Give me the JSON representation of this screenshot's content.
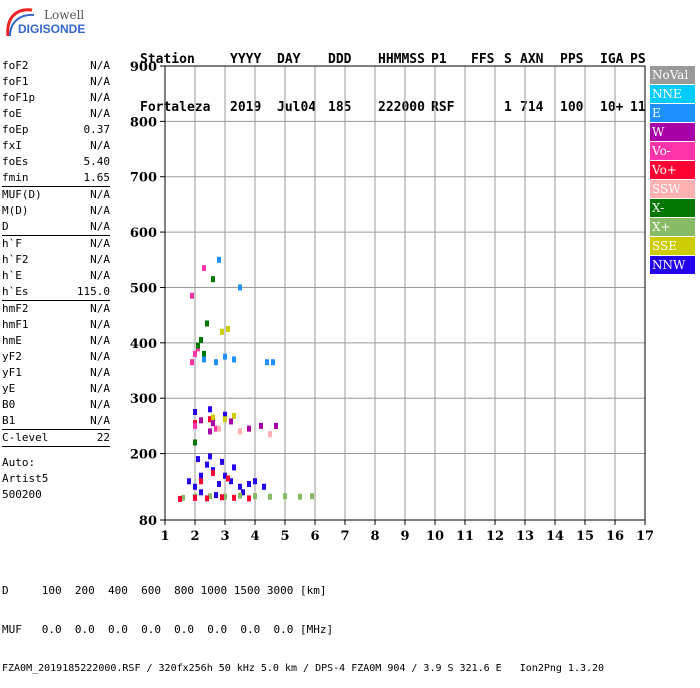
{
  "logo": {
    "line1": "Lowell",
    "line2": "DIGISONDE"
  },
  "header": {
    "labels": [
      "Station",
      "YYYY",
      "DAY",
      "DDD",
      "HHMMSS",
      "P1",
      "FFS",
      "S",
      "AXN",
      "PPS",
      "IGA",
      "PS"
    ],
    "values": [
      "Fortaleza",
      "2019",
      "Jul04",
      "185",
      "222000",
      "RSF",
      "",
      "1",
      "714",
      "100",
      "10+",
      "11"
    ]
  },
  "params": [
    {
      "label": "foF2",
      "value": "N/A"
    },
    {
      "label": "foF1",
      "value": "N/A"
    },
    {
      "label": "foF1p",
      "value": "N/A"
    },
    {
      "label": "foE",
      "value": "N/A"
    },
    {
      "label": "foEp",
      "value": "0.37"
    },
    {
      "label": "fxI",
      "value": "N/A"
    },
    {
      "label": "foEs",
      "value": "5.40"
    },
    {
      "label": "fmin",
      "value": "1.65",
      "sep": true
    },
    {
      "label": "MUF(D)",
      "value": "N/A"
    },
    {
      "label": "M(D)",
      "value": "N/A"
    },
    {
      "label": "D",
      "value": "N/A",
      "sep": true
    },
    {
      "label": "h`F",
      "value": "N/A"
    },
    {
      "label": "h`F2",
      "value": "N/A"
    },
    {
      "label": "h`E",
      "value": "N/A"
    },
    {
      "label": "h`Es",
      "value": "115.0",
      "sep": true
    },
    {
      "label": "hmF2",
      "value": "N/A"
    },
    {
      "label": "hmF1",
      "value": "N/A"
    },
    {
      "label": "hmE",
      "value": "N/A"
    },
    {
      "label": "yF2",
      "value": "N/A"
    },
    {
      "label": "yF1",
      "value": "N/A"
    },
    {
      "label": "yE",
      "value": "N/A"
    },
    {
      "label": "B0",
      "value": "N/A"
    },
    {
      "label": "B1",
      "value": "N/A",
      "sep": true
    },
    {
      "label": "C-level",
      "value": "22",
      "sep": true
    }
  ],
  "auto": [
    "Auto:",
    "Artist5",
    "500200"
  ],
  "legend": [
    {
      "label": "NoVal",
      "color": "#999999"
    },
    {
      "label": "NNE",
      "color": "#00ccff"
    },
    {
      "label": "E",
      "color": "#1e90ff"
    },
    {
      "label": "W",
      "color": "#a600a6"
    },
    {
      "label": "Vo-",
      "color": "#ff33aa"
    },
    {
      "label": "Vo+",
      "color": "#ff0033"
    },
    {
      "label": "SSW",
      "color": "#ffb0b0"
    },
    {
      "label": "X-",
      "color": "#007700"
    },
    {
      "label": "X+",
      "color": "#88bb66"
    },
    {
      "label": "SSE",
      "color": "#cccc00"
    },
    {
      "label": "NNW",
      "color": "#2200ee"
    }
  ],
  "footer": {
    "line1": "D     100  200  400  600  800 1000 1500 3000 [km]",
    "line2": "MUF   0.0  0.0  0.0  0.0  0.0  0.0  0.0  0.0 [MHz]",
    "line3": "FZA0M_2019185222000.RSF / 320fx256h 50 kHz 5.0 km / DPS-4 FZA0M 904 / 3.9 S 321.6 E   Ion2Png 1.3.20"
  },
  "chart_data": {
    "type": "scatter",
    "xlim": [
      1,
      17
    ],
    "ylim": [
      80,
      900
    ],
    "x_ticks": [
      1,
      2,
      3,
      4,
      5,
      6,
      7,
      8,
      9,
      10,
      11,
      12,
      13,
      14,
      15,
      16,
      17
    ],
    "y_ticks": [
      80,
      200,
      300,
      400,
      500,
      600,
      700,
      800,
      900
    ],
    "grid": true,
    "series": [
      {
        "name": "NNW",
        "color": "#2200ee",
        "points": [
          [
            1.8,
            150
          ],
          [
            2.0,
            140
          ],
          [
            2.2,
            160
          ],
          [
            2.4,
            180
          ],
          [
            2.6,
            170
          ],
          [
            2.8,
            145
          ],
          [
            3.0,
            160
          ],
          [
            3.2,
            150
          ],
          [
            3.5,
            140
          ],
          [
            3.8,
            145
          ],
          [
            4.0,
            150
          ],
          [
            4.3,
            140
          ],
          [
            2.1,
            190
          ],
          [
            2.5,
            195
          ],
          [
            2.9,
            185
          ],
          [
            3.3,
            175
          ],
          [
            2.2,
            130
          ],
          [
            2.7,
            125
          ],
          [
            3.6,
            130
          ],
          [
            2.0,
            275
          ],
          [
            2.5,
            280
          ],
          [
            3.0,
            270
          ]
        ]
      },
      {
        "name": "X+",
        "color": "#88bb66",
        "points": [
          [
            1.6,
            120
          ],
          [
            2.0,
            122
          ],
          [
            2.5,
            123
          ],
          [
            3.0,
            122
          ],
          [
            3.5,
            124
          ],
          [
            4.0,
            123
          ],
          [
            4.5,
            122
          ],
          [
            5.0,
            123
          ],
          [
            5.5,
            122
          ],
          [
            5.9,
            123
          ]
        ]
      },
      {
        "name": "Vo+",
        "color": "#ff0033",
        "points": [
          [
            1.5,
            118
          ],
          [
            2.0,
            120
          ],
          [
            2.4,
            119
          ],
          [
            2.9,
            121
          ],
          [
            3.3,
            120
          ],
          [
            3.8,
            119
          ],
          [
            2.2,
            150
          ],
          [
            2.6,
            165
          ],
          [
            3.1,
            155
          ],
          [
            2.0,
            255
          ],
          [
            2.5,
            262
          ]
        ]
      },
      {
        "name": "Vo-",
        "color": "#ff33aa",
        "points": [
          [
            1.9,
            365
          ],
          [
            2.0,
            380
          ],
          [
            2.1,
            390
          ],
          [
            1.9,
            485
          ],
          [
            2.3,
            535
          ],
          [
            2.0,
            250
          ],
          [
            2.7,
            245
          ]
        ]
      },
      {
        "name": "X-",
        "color": "#007700",
        "points": [
          [
            2.1,
            395
          ],
          [
            2.2,
            405
          ],
          [
            2.4,
            435
          ],
          [
            2.6,
            515
          ],
          [
            2.0,
            220
          ],
          [
            2.3,
            380
          ]
        ]
      },
      {
        "name": "SSE",
        "color": "#cccc00",
        "points": [
          [
            2.6,
            265
          ],
          [
            3.0,
            262
          ],
          [
            3.3,
            268
          ],
          [
            2.9,
            420
          ],
          [
            3.1,
            425
          ]
        ]
      },
      {
        "name": "E",
        "color": "#1e90ff",
        "points": [
          [
            2.3,
            370
          ],
          [
            2.7,
            365
          ],
          [
            3.0,
            375
          ],
          [
            3.3,
            370
          ],
          [
            4.4,
            365
          ],
          [
            4.6,
            365
          ],
          [
            3.5,
            500
          ],
          [
            2.8,
            550
          ]
        ]
      },
      {
        "name": "W",
        "color": "#a600a6",
        "points": [
          [
            2.2,
            260
          ],
          [
            2.6,
            255
          ],
          [
            3.2,
            258
          ],
          [
            3.8,
            245
          ],
          [
            4.2,
            250
          ],
          [
            4.7,
            250
          ],
          [
            2.5,
            240
          ]
        ]
      },
      {
        "name": "SSW",
        "color": "#ffb0b0",
        "points": [
          [
            2.8,
            245
          ],
          [
            3.5,
            240
          ],
          [
            4.5,
            235
          ]
        ]
      }
    ]
  }
}
